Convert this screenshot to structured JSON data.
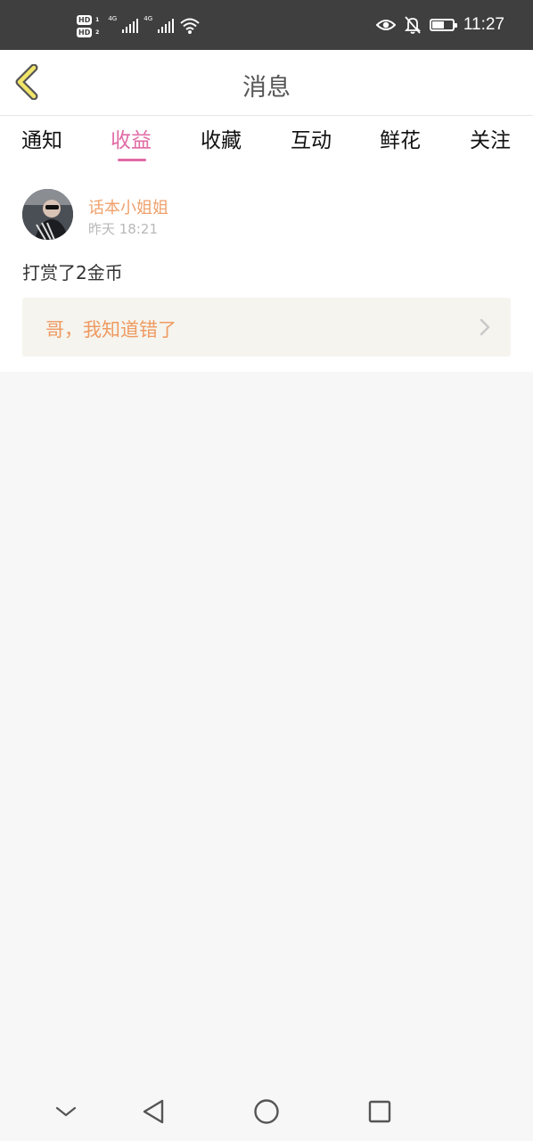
{
  "status_bar": {
    "sim1": "HD",
    "sim1_index": "1",
    "sim2": "HD",
    "sim2_index": "2",
    "net1": "4G",
    "net2": "4G",
    "time": "11:27",
    "battery_level": 0.6,
    "icons": [
      "eye-comfort-icon",
      "bell-off-icon",
      "battery-icon",
      "wifi-icon",
      "signal-icon"
    ]
  },
  "header": {
    "title": "消息",
    "back_icon": "chevron-left-icon",
    "accent": "#f1e56a"
  },
  "tabs": [
    {
      "label": "通知",
      "active": false
    },
    {
      "label": "收益",
      "active": true
    },
    {
      "label": "收藏",
      "active": false
    },
    {
      "label": "互动",
      "active": false
    },
    {
      "label": "鲜花",
      "active": false
    },
    {
      "label": "关注",
      "active": false
    }
  ],
  "message": {
    "username": "话本小姐姐",
    "timestamp": "昨天 18:21",
    "content": "打赏了2金币",
    "quote": "哥，我知道错了",
    "quote_icon": "chevron-right-icon"
  },
  "colors": {
    "active_tab": "#e06aa4",
    "username": "#f0a06b",
    "quote_text": "#ef9a61",
    "quote_bg": "#f5f4ee"
  },
  "navbar": {
    "icons": [
      "collapse-icon",
      "back-triangle-icon",
      "home-circle-icon",
      "recents-square-icon"
    ]
  }
}
